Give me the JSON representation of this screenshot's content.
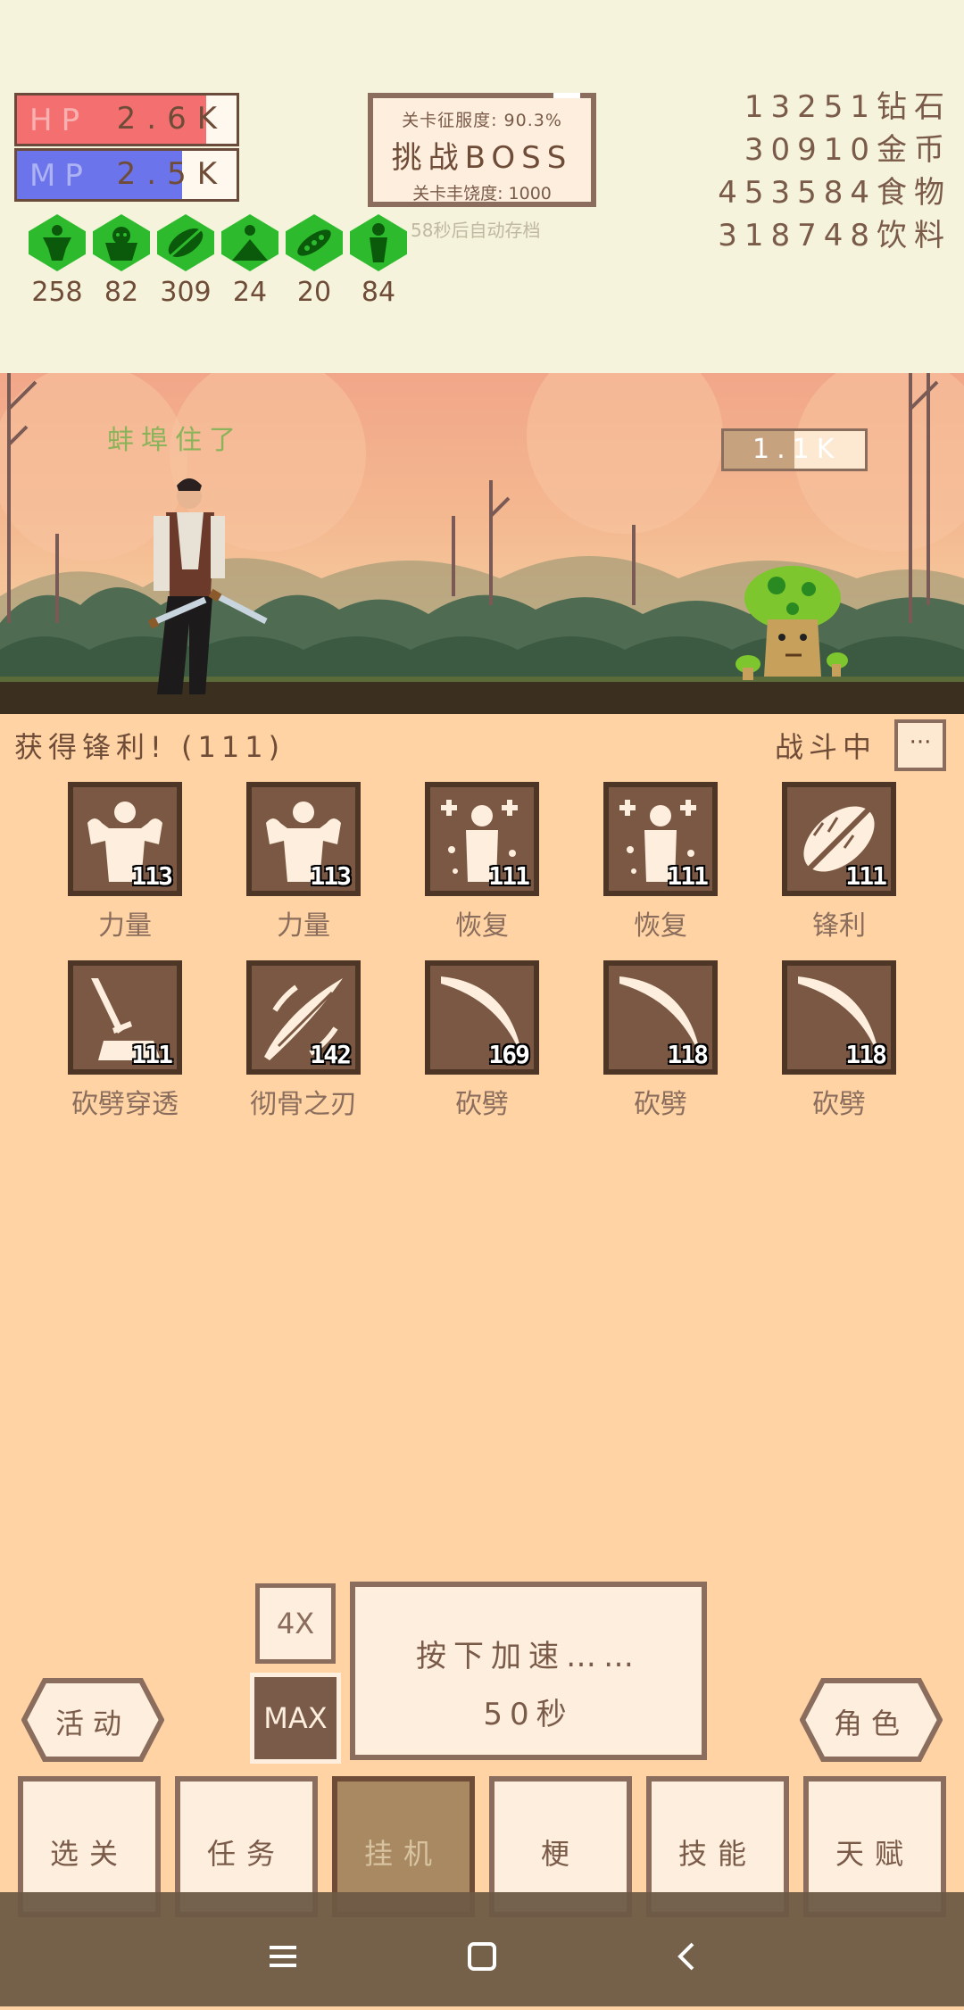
{
  "hud": {
    "hp": {
      "label": "HP",
      "value": "2.6K",
      "fraction": 0.86,
      "color": "#f47070"
    },
    "mp": {
      "label": "MP",
      "value": "2.5K",
      "fraction": 0.75,
      "color": "#6b74ea"
    },
    "boss": {
      "conquest": "关卡征服度: 90.3%",
      "button": "挑战BOSS",
      "richness": "关卡丰饶度: 1000"
    },
    "autosave": "58秒后自动存档",
    "resources": [
      {
        "value": "13251",
        "label": "钻石"
      },
      {
        "value": "30910",
        "label": "金币"
      },
      {
        "value": "453584",
        "label": "食物"
      },
      {
        "value": "318748",
        "label": "饮料"
      }
    ],
    "stats": [
      {
        "icon": "strength-icon",
        "value": "258"
      },
      {
        "icon": "monster-icon",
        "value": "82"
      },
      {
        "icon": "leaf-blade-icon",
        "value": "309"
      },
      {
        "icon": "dig-icon",
        "value": "24"
      },
      {
        "icon": "pea-pod-icon",
        "value": "20"
      },
      {
        "icon": "figure-icon",
        "value": "84"
      }
    ]
  },
  "scene": {
    "dialog": "蚌埠住了",
    "enemy_hp": "1.1K",
    "enemy_hp_fraction": 0.5
  },
  "log": {
    "message": "获得锋利! (111)",
    "state": "战斗中",
    "more": "···"
  },
  "skills": [
    {
      "name": "力量",
      "level": "113",
      "icon": "muscle-icon"
    },
    {
      "name": "力量",
      "level": "113",
      "icon": "muscle-icon"
    },
    {
      "name": "恢复",
      "level": "111",
      "icon": "heal-icon"
    },
    {
      "name": "恢复",
      "level": "111",
      "icon": "heal-icon"
    },
    {
      "name": "锋利",
      "level": "111",
      "icon": "sharp-sword-icon"
    },
    {
      "name": "砍劈穿透",
      "level": "111",
      "icon": "sword-pierce-icon"
    },
    {
      "name": "彻骨之刃",
      "level": "142",
      "icon": "slash-blade-icon"
    },
    {
      "name": "砍劈",
      "level": "169",
      "icon": "slash-icon"
    },
    {
      "name": "砍劈",
      "level": "118",
      "icon": "slash-icon"
    },
    {
      "name": "砍劈",
      "level": "118",
      "icon": "slash-icon"
    }
  ],
  "controls": {
    "speed_4x": "4X",
    "speed_max": "MAX",
    "accelerate_line1": "按下加速……",
    "accelerate_line2": "50秒",
    "activity": "活动",
    "character": "角色"
  },
  "nav": [
    {
      "label": "选关"
    },
    {
      "label": "任务"
    },
    {
      "label": "挂机",
      "active": true
    },
    {
      "label": "梗"
    },
    {
      "label": "技能"
    },
    {
      "label": "天赋"
    }
  ]
}
